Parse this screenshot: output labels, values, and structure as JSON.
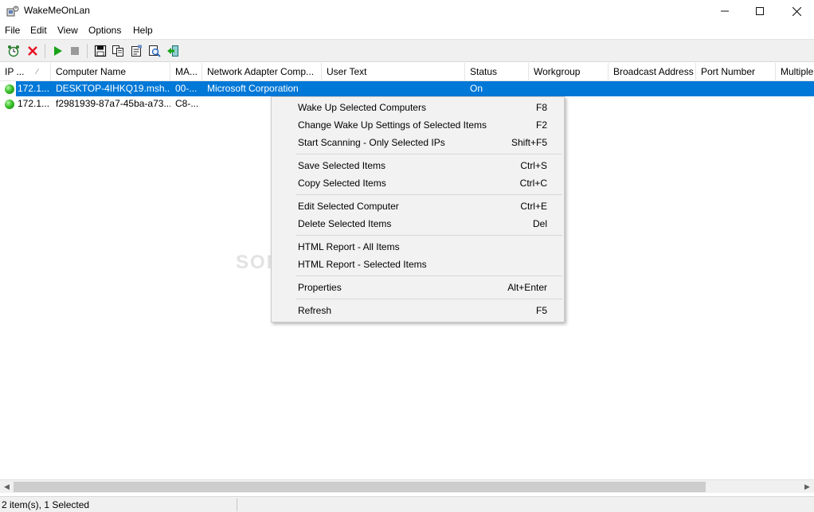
{
  "window": {
    "title": "WakeMeOnLan"
  },
  "menu": [
    "File",
    "Edit",
    "View",
    "Options",
    "Help"
  ],
  "toolbar": {
    "icons": [
      "alarm-clock-icon",
      "delete-x-icon",
      "play-start-icon",
      "stop-icon",
      "save-icon",
      "copy-icon",
      "properties-icon",
      "find-icon",
      "exit-icon"
    ]
  },
  "columns": [
    "IP ...",
    "Computer Name",
    "MA...",
    "Network Adapter Comp...",
    "User Text",
    "Status",
    "Workgroup",
    "Broadcast Address",
    "Port Number",
    "Multiple"
  ],
  "sort_indicator": "∕",
  "rows": [
    {
      "ip": "172.1...",
      "name": "DESKTOP-4IHKQ19.msh...",
      "mac": "00-...",
      "adapter": "Microsoft Corporation",
      "user_text": "",
      "status": "On",
      "selected": true
    },
    {
      "ip": "172.1...",
      "name": "f2981939-87a7-45ba-a73...",
      "mac": "C8-...",
      "adapter": "",
      "user_text": "",
      "status": "",
      "selected": false
    }
  ],
  "context_menu": {
    "items": [
      {
        "label": "Wake Up Selected Computers",
        "key": "F8"
      },
      {
        "label": "Change Wake Up Settings of Selected Items",
        "key": "F2"
      },
      {
        "label": "Start Scanning - Only Selected IPs",
        "key": "Shift+F5"
      },
      {
        "label": "Save Selected Items",
        "key": "Ctrl+S"
      },
      {
        "label": "Copy Selected Items",
        "key": "Ctrl+C"
      },
      {
        "label": "Edit Selected Computer",
        "key": "Ctrl+E"
      },
      {
        "label": "Delete Selected Items",
        "key": "Del"
      },
      {
        "label": "HTML Report - All Items",
        "key": ""
      },
      {
        "label": "HTML Report - Selected Items",
        "key": ""
      },
      {
        "label": "Properties",
        "key": "Alt+Enter"
      },
      {
        "label": "Refresh",
        "key": "F5"
      }
    ]
  },
  "statusbar": {
    "text": "2 item(s), 1 Selected"
  },
  "watermark": "SOFTPEDIA",
  "colors": {
    "selection": "#0078d7",
    "led_on": "#37c12a",
    "close_x": "#e81123",
    "play": "#1aa31a"
  }
}
